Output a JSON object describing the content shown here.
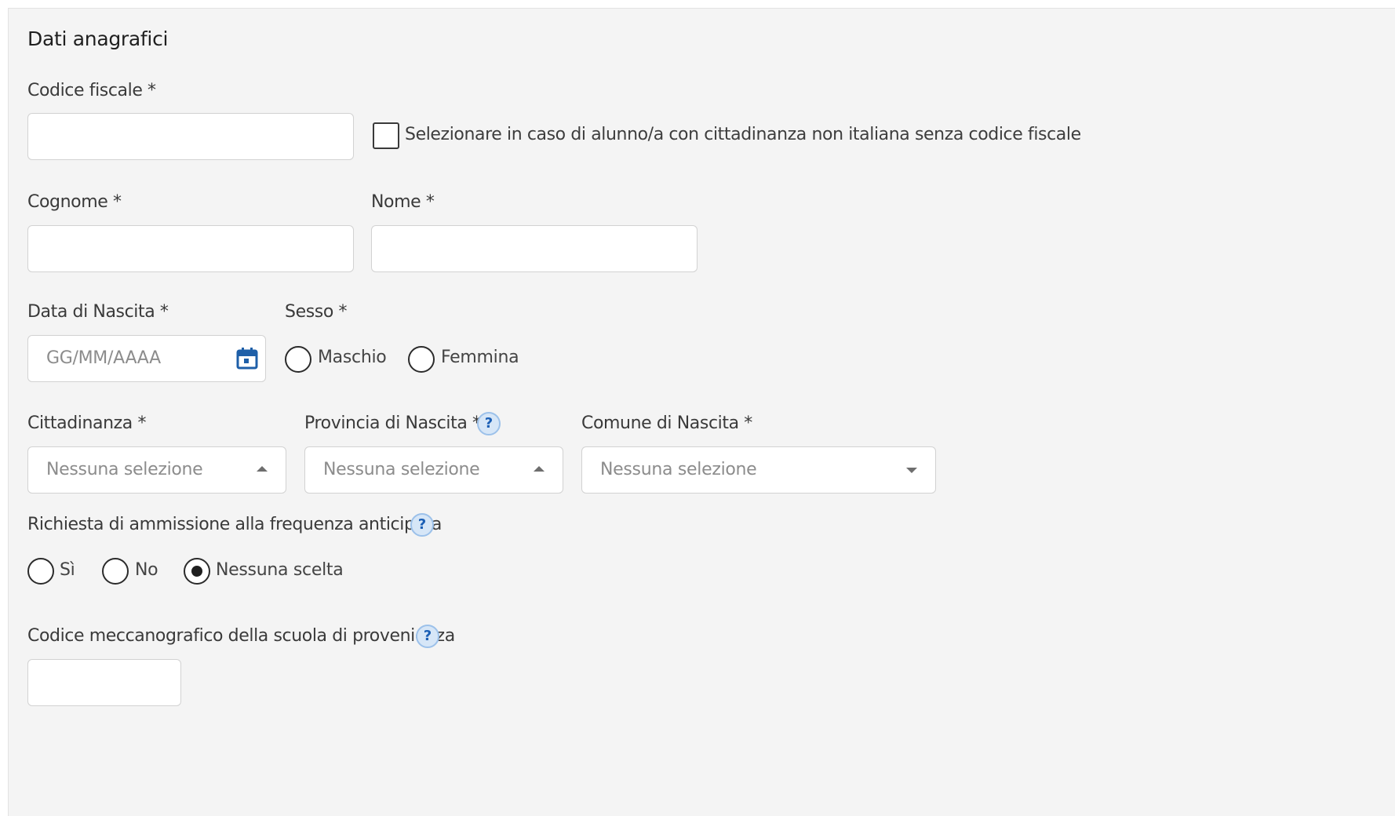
{
  "section": {
    "title": "Dati anagrafici"
  },
  "codice_fiscale": {
    "label": "Codice fiscale *",
    "value": "",
    "no_cf_checkbox_label": "Selezionare in caso di alunno/a con cittadinanza non italiana senza codice fiscale",
    "no_cf_checked": false
  },
  "cognome": {
    "label": "Cognome *",
    "value": ""
  },
  "nome": {
    "label": "Nome *",
    "value": ""
  },
  "data_nascita": {
    "label": "Data di Nascita *",
    "placeholder": "GG/MM/AAAA",
    "icon": "calendar-icon"
  },
  "sesso": {
    "label": "Sesso *",
    "options": [
      "Maschio",
      "Femmina"
    ],
    "selected": null
  },
  "cittadinanza": {
    "label": "Cittadinanza *",
    "selected": "Nessuna selezione"
  },
  "provincia_nascita": {
    "label": "Provincia di Nascita *",
    "selected": "Nessuna selezione",
    "help": "?"
  },
  "comune_nascita": {
    "label": "Comune di Nascita *",
    "selected": "Nessuna selezione"
  },
  "frequenza_anticipata": {
    "label": "Richiesta di ammissione alla frequenza anticipata",
    "help": "?",
    "options": [
      "Sì",
      "No",
      "Nessuna scelta"
    ],
    "selected": "Nessuna scelta"
  },
  "codice_meccanografico": {
    "label": "Codice meccanografico della scuola di provenienza",
    "help": "?",
    "value": ""
  },
  "colors": {
    "panel_bg": "#f4f4f4",
    "input_border": "#d2d2d2",
    "help_icon": "#1b5fb5",
    "calendar_icon": "#1e5fa8"
  }
}
